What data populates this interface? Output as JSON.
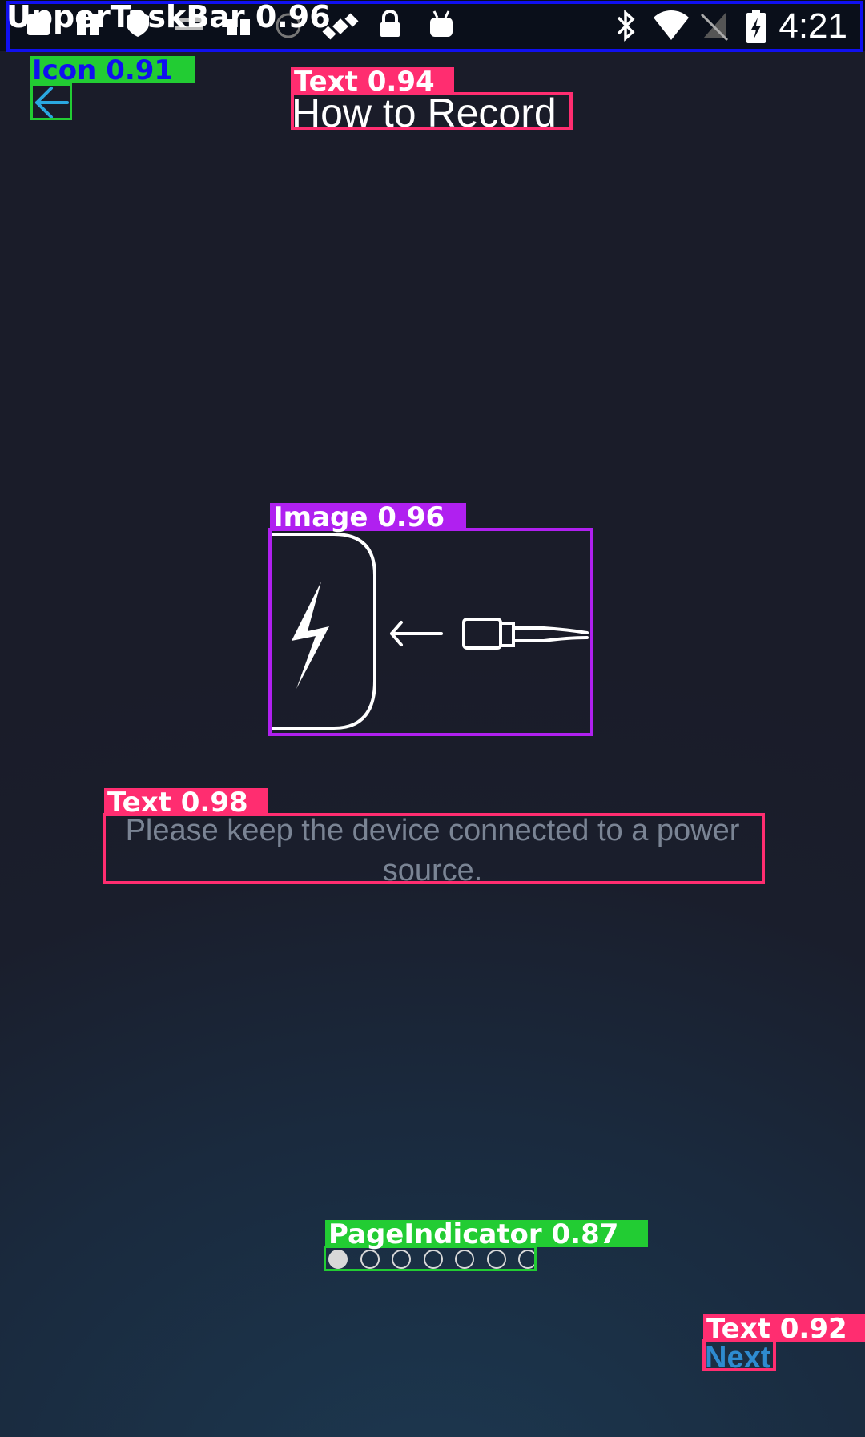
{
  "status_bar": {
    "time": "4:21",
    "left_icons": [
      "notification-icon",
      "notification-icon",
      "shield-icon",
      "badge-icon",
      "notification-icon",
      "circle-icon",
      "satellite-icon",
      "lock-icon",
      "android-icon"
    ],
    "right_icons": [
      "bluetooth-icon",
      "wifi-icon",
      "no-sim-icon",
      "battery-charging-icon"
    ]
  },
  "header": {
    "title": "How to Record",
    "back_icon": "back-arrow-icon"
  },
  "illustration": {
    "icon": "charging-device-illustration"
  },
  "message": {
    "text": "Please keep the device connected to a power source."
  },
  "pager": {
    "total": 7,
    "active_index": 0
  },
  "footer": {
    "next_label": "Next"
  },
  "annotations": {
    "upper_task_bar": "UpperTaskBar 0.96",
    "icon": "Icon 0.91",
    "title_text": "Text 0.94",
    "image": "Image 0.96",
    "message_text": "Text 0.98",
    "page_indicator": "PageIndicator 0.87",
    "next_text": "Text 0.92"
  },
  "colors": {
    "text_box": "#ff2d70",
    "image_box": "#b020f0",
    "icon_box": "#22cc33",
    "taskbar_box": "#1010f0",
    "message_text": "#7a8494",
    "next_text": "#2e8bd0",
    "back_icon": "#2aa8e0"
  }
}
